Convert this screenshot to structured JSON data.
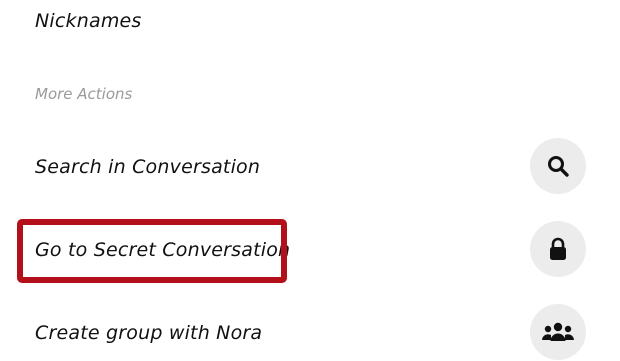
{
  "menu": {
    "nicknames_label": "Nicknames",
    "section_header": "More Actions",
    "items": [
      {
        "label": "Search in Conversation",
        "icon": "search-icon"
      },
      {
        "label": "Go to Secret Conversation",
        "icon": "lock-icon"
      },
      {
        "label": "Create group with Nora",
        "icon": "group-icon"
      }
    ]
  },
  "colors": {
    "highlight": "#b3101b",
    "icon_bg": "#ececec",
    "section_header": "#9a9a9a"
  }
}
